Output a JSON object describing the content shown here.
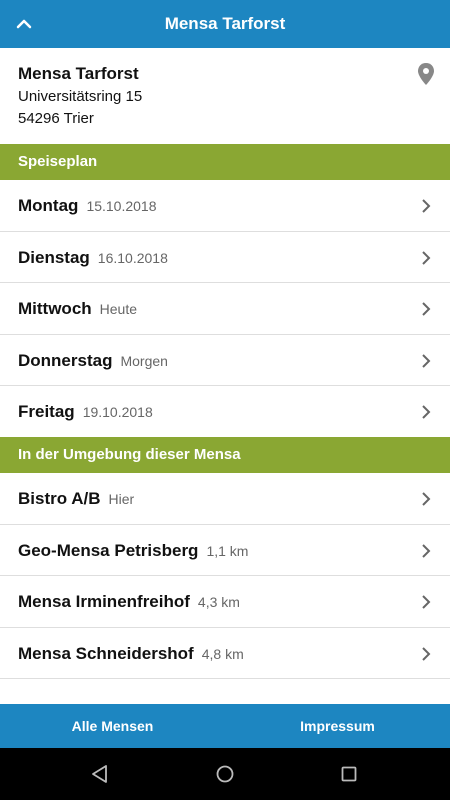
{
  "header": {
    "title": "Mensa Tarforst",
    "up_icon": "chevron-up-icon"
  },
  "info": {
    "name": "Mensa Tarforst",
    "street": "Universitätsring 15",
    "city": "54296 Trier",
    "location_icon": "map-pin-icon"
  },
  "speiseplan": {
    "title": "Speiseplan",
    "items": [
      {
        "day": "Montag",
        "date": "15.10.2018"
      },
      {
        "day": "Dienstag",
        "date": "16.10.2018"
      },
      {
        "day": "Mittwoch",
        "date": "Heute"
      },
      {
        "day": "Donnerstag",
        "date": "Morgen"
      },
      {
        "day": "Freitag",
        "date": "19.10.2018"
      }
    ]
  },
  "nearby": {
    "title": "In der Umgebung dieser Mensa",
    "items": [
      {
        "name": "Bistro A/B",
        "distance": "Hier"
      },
      {
        "name": "Geo-Mensa Petrisberg",
        "distance": "1,1 km"
      },
      {
        "name": "Mensa Irminenfreihof",
        "distance": "4,3 km"
      },
      {
        "name": "Mensa Schneidershof",
        "distance": "4,8 km"
      }
    ]
  },
  "bottom": {
    "all": "Alle Mensen",
    "imprint": "Impressum"
  },
  "colors": {
    "primary": "#1d86c1",
    "section": "#8aa733",
    "text": "#111111",
    "secondary_text": "#666666"
  }
}
